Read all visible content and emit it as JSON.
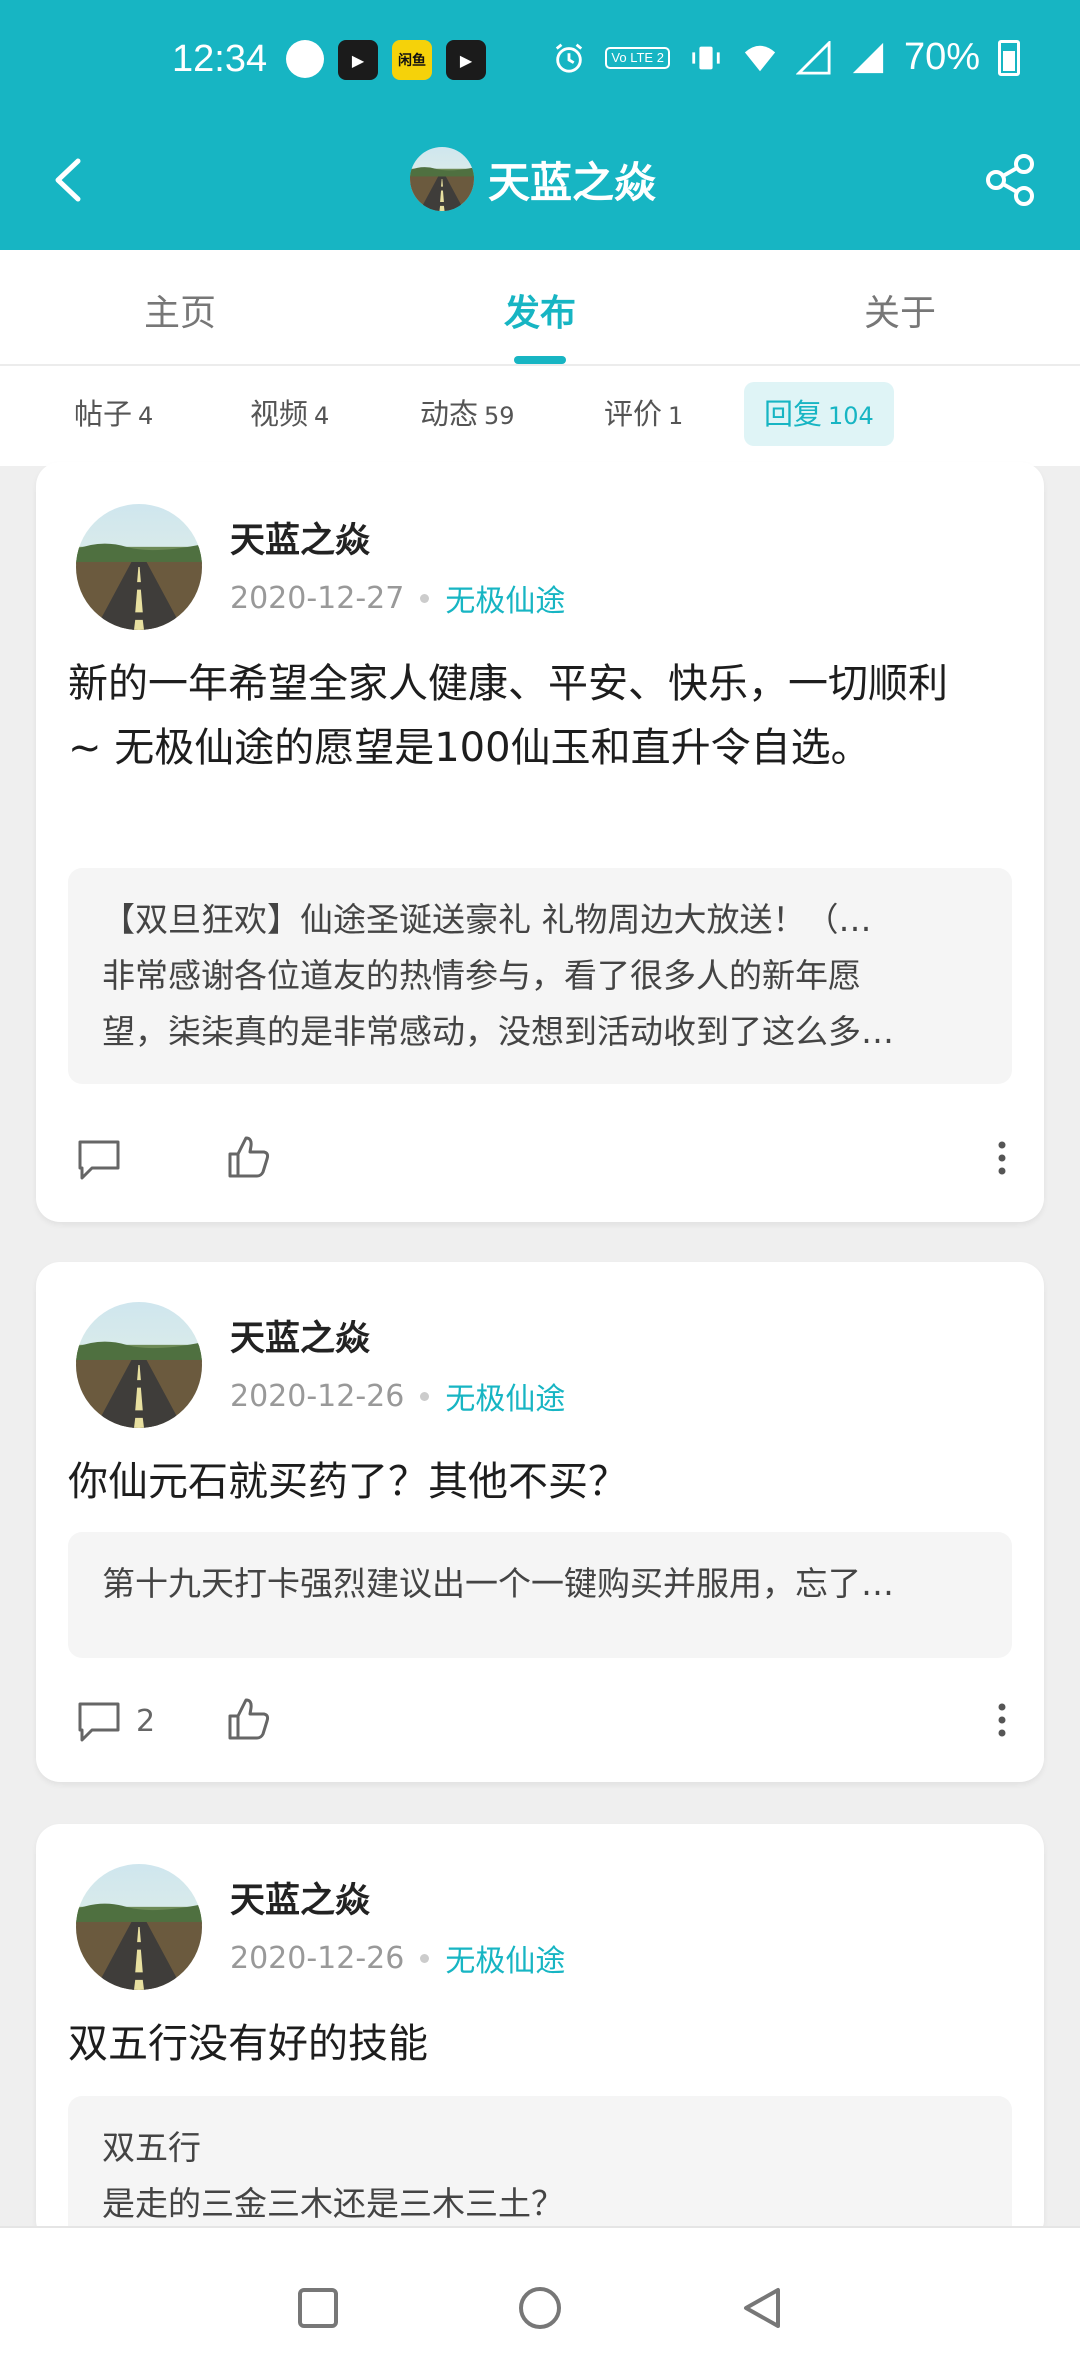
{
  "status_bar": {
    "time": "12:34",
    "app_icon_label": "闲鱼",
    "lte_label": "Vo LTE 2",
    "battery": "70%"
  },
  "header": {
    "title": "天蓝之焱"
  },
  "tabs": [
    {
      "label": "主页",
      "active": false
    },
    {
      "label": "发布",
      "active": true
    },
    {
      "label": "关于",
      "active": false
    }
  ],
  "subtabs": [
    {
      "label": "帖子",
      "count": "4",
      "active": false
    },
    {
      "label": "视频",
      "count": "4",
      "active": false
    },
    {
      "label": "动态",
      "count": "59",
      "active": false
    },
    {
      "label": "评价",
      "count": "1",
      "active": false
    },
    {
      "label": "回复",
      "count": "104",
      "active": true
    }
  ],
  "posts": [
    {
      "author": "天蓝之焱",
      "date": "2020-12-27",
      "game": "无极仙途",
      "text_lines": [
        "新的一年希望全家人健康、平安、快乐，一切顺利",
        "~ 无极仙途的愿望是100仙玉和直升令自选。"
      ],
      "quote_lines": [
        "【双旦狂欢】仙途圣诞送豪礼 礼物周边大放送！（…",
        "非常感谢各位道友的热情参与，看了很多人的新年愿",
        "望，柒柒真的是非常感动，没想到活动收到了这么多…"
      ],
      "comment_count": ""
    },
    {
      "author": "天蓝之焱",
      "date": "2020-12-26",
      "game": "无极仙途",
      "text_lines": [
        "你仙元石就买药了？其他不买？"
      ],
      "quote_lines": [
        "第十九天打卡强烈建议出一个一键购买并服用，忘了…"
      ],
      "comment_count": "2"
    },
    {
      "author": "天蓝之焱",
      "date": "2020-12-26",
      "game": "无极仙途",
      "text_lines": [
        "双五行没有好的技能"
      ],
      "quote_lines": [
        "双五行",
        "是走的三金三木还是三木三土？"
      ],
      "comment_count": ""
    }
  ],
  "colors": {
    "accent": "#17b5c3",
    "background": "#efefef"
  }
}
